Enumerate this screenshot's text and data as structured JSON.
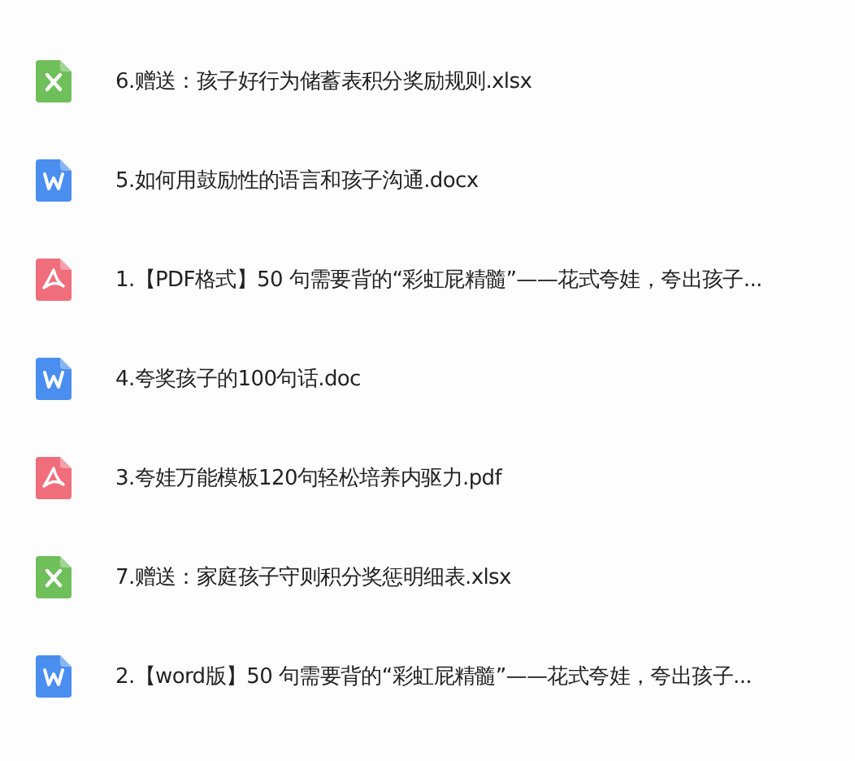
{
  "files": [
    {
      "kind": "xlsx",
      "name": "6.赠送：孩子好行为储蓄表积分奖励规则.xlsx"
    },
    {
      "kind": "docx",
      "name": "5.如何用鼓励性的语言和孩子沟通.docx"
    },
    {
      "kind": "pdf",
      "name": "1.【PDF格式】50 句需要背的“彩虹屁精髓”——花式夸娃，夸出孩子..."
    },
    {
      "kind": "docx",
      "name": "4.夸奖孩子的100句话.doc"
    },
    {
      "kind": "pdf",
      "name": "3.夸娃万能模板120句轻松培养内驱力.pdf"
    },
    {
      "kind": "xlsx",
      "name": "7.赠送：家庭孩子守则积分奖惩明细表.xlsx"
    },
    {
      "kind": "docx",
      "name": "2.【word版】50 句需要背的“彩虹屁精髓”——花式夸娃，夸出孩子..."
    }
  ]
}
